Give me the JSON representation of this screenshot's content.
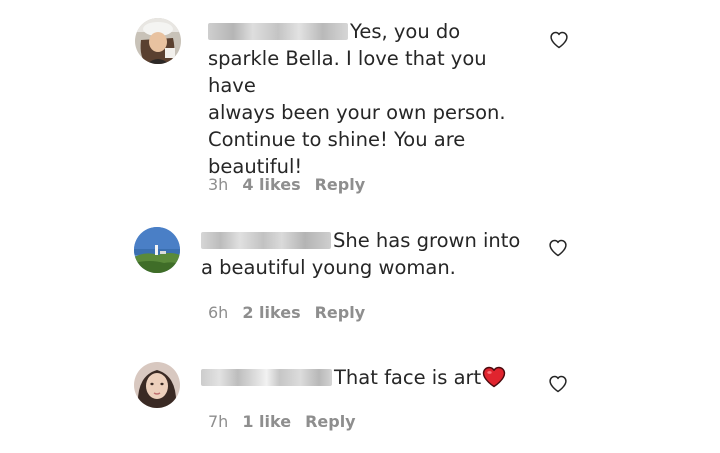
{
  "comments": [
    {
      "username": "",
      "text_lines": [
        "Yes, you do",
        "sparkle Bella. I love that you have",
        "always been your own person.",
        "Continue to shine! You are",
        "beautiful!"
      ],
      "time": "3h",
      "likes": "4 likes",
      "reply": "Reply"
    },
    {
      "username": "",
      "text_lines": [
        "She has grown into",
        "a beautiful young woman."
      ],
      "time": "6h",
      "likes": "2 likes",
      "reply": "Reply"
    },
    {
      "username": "",
      "text_lines": [
        "That face is art"
      ],
      "time": "7h",
      "likes": "1 like",
      "reply": "Reply"
    }
  ],
  "icons": {
    "like": "heart-outline-icon",
    "emoji": "red-heart-emoji"
  },
  "colors": {
    "text": "#262626",
    "meta": "#8e8e8e",
    "emoji_heart": "#e0242e"
  }
}
